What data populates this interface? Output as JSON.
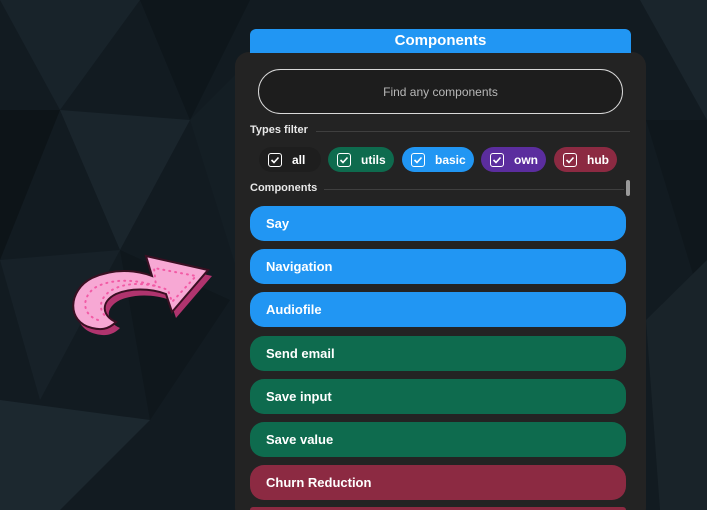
{
  "header": {
    "title": "Components"
  },
  "search": {
    "placeholder": "Find any components"
  },
  "types_filter": {
    "label": "Types filter",
    "chips": [
      {
        "label": "all",
        "color": "#1e1e1e",
        "checked": true
      },
      {
        "label": "utils",
        "color": "#0e6b4e",
        "checked": true
      },
      {
        "label": "basic",
        "color": "#2196f3",
        "checked": true
      },
      {
        "label": "own",
        "color": "#5b2d9e",
        "checked": true
      },
      {
        "label": "hub",
        "color": "#8c2a42",
        "checked": true
      }
    ]
  },
  "components": {
    "label": "Components",
    "items": [
      {
        "label": "Say",
        "color": "#2196f3"
      },
      {
        "label": "Navigation",
        "color": "#2196f3"
      },
      {
        "label": "Audiofile",
        "color": "#2196f3"
      },
      {
        "label": "Send email",
        "color": "#0e6b4e"
      },
      {
        "label": "Save input",
        "color": "#0e6b4e"
      },
      {
        "label": "Save value",
        "color": "#0e6b4e"
      },
      {
        "label": "Churn Reduction",
        "color": "#8c2a42"
      },
      {
        "label": "",
        "color": "#8c2a42"
      }
    ]
  },
  "decor": {
    "arrow_icon": "arrow-icon",
    "arrow_color": "#f7a8d4"
  }
}
